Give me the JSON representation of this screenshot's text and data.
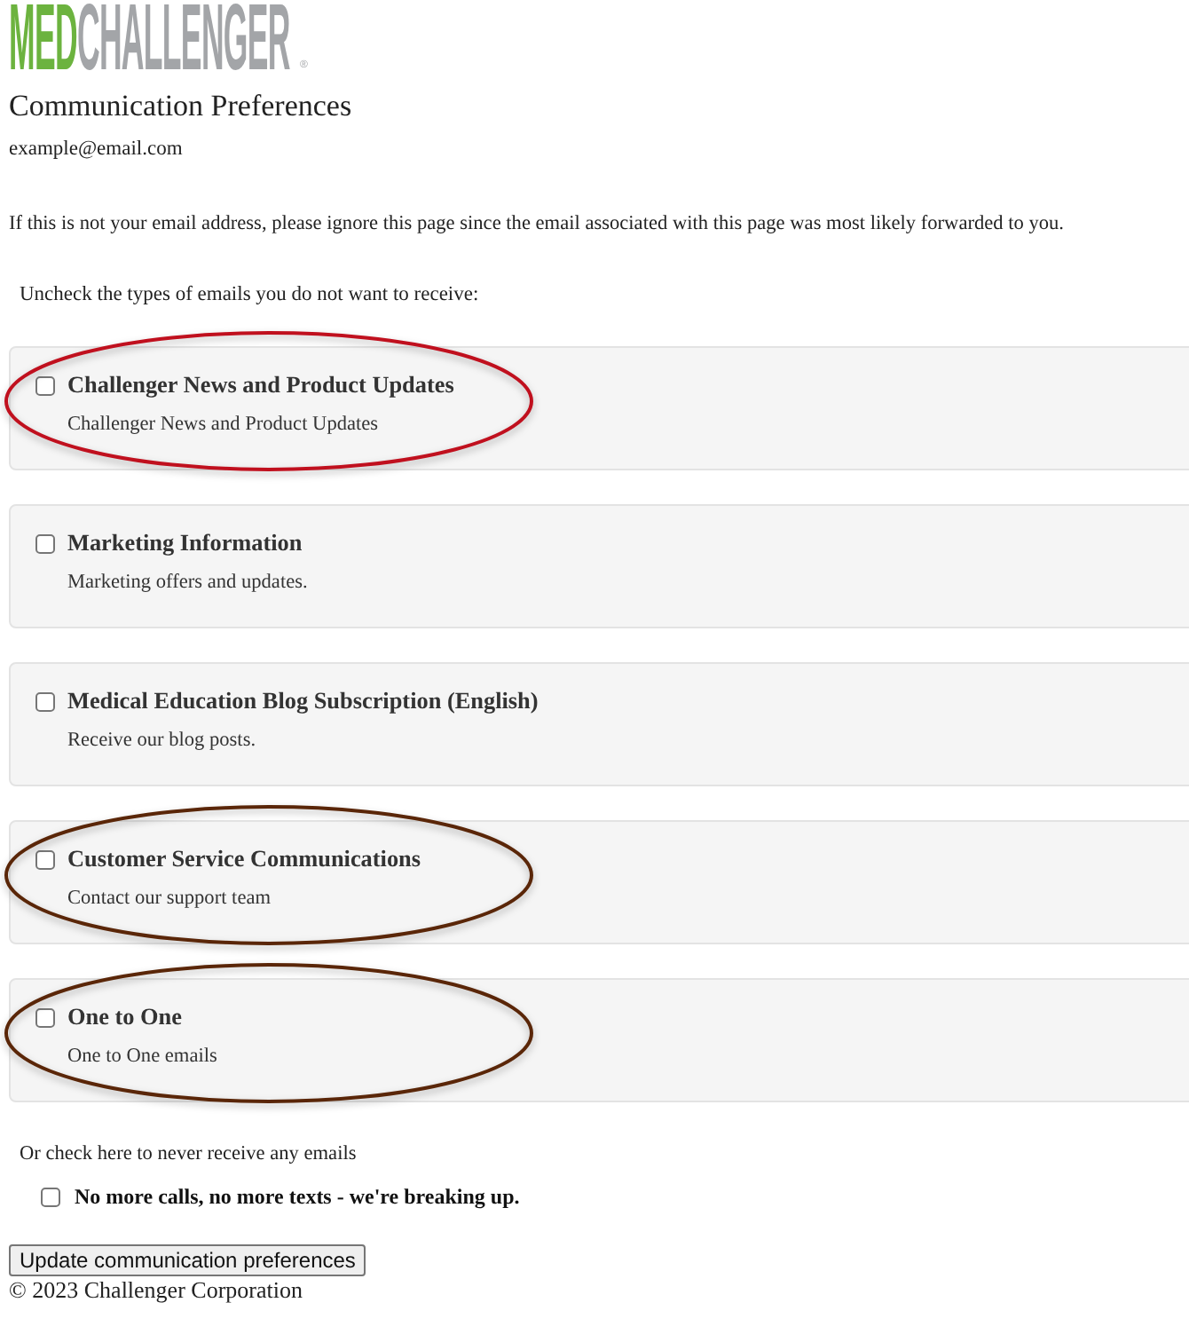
{
  "logo": {
    "accent": "MED",
    "rest": "CHALLENGER",
    "mark": "®"
  },
  "title": "Communication Preferences",
  "email": "example@email.com",
  "notice": "If this is not your email address, please ignore this page since the email associated with this page was most likely forwarded to you.",
  "instruction": "Uncheck the types of emails you do not want to receive:",
  "subscriptions": [
    {
      "name": "Challenger News and Product Updates",
      "description": "Challenger News and Product Updates",
      "checked": false,
      "circled": true,
      "color": "#c0101e"
    },
    {
      "name": "Marketing Information",
      "description": "Marketing offers and updates.",
      "checked": false,
      "circled": false
    },
    {
      "name": "Medical Education Blog Subscription (English)",
      "description": "Receive our blog posts.",
      "checked": false,
      "circled": false
    },
    {
      "name": "Customer Service Communications",
      "description": "Contact our support team",
      "checked": false,
      "circled": true,
      "color": "#5a2608"
    },
    {
      "name": "One to One",
      "description": "One to One emails",
      "checked": false,
      "circled": true,
      "color": "#5a2608"
    }
  ],
  "opt_out": {
    "prompt": "Or check here to never receive any emails",
    "label": "No more calls, no more texts - we're breaking up.",
    "checked": false
  },
  "submit_button": "Update communication preferences",
  "footer": "© 2023 Challenger Corporation"
}
